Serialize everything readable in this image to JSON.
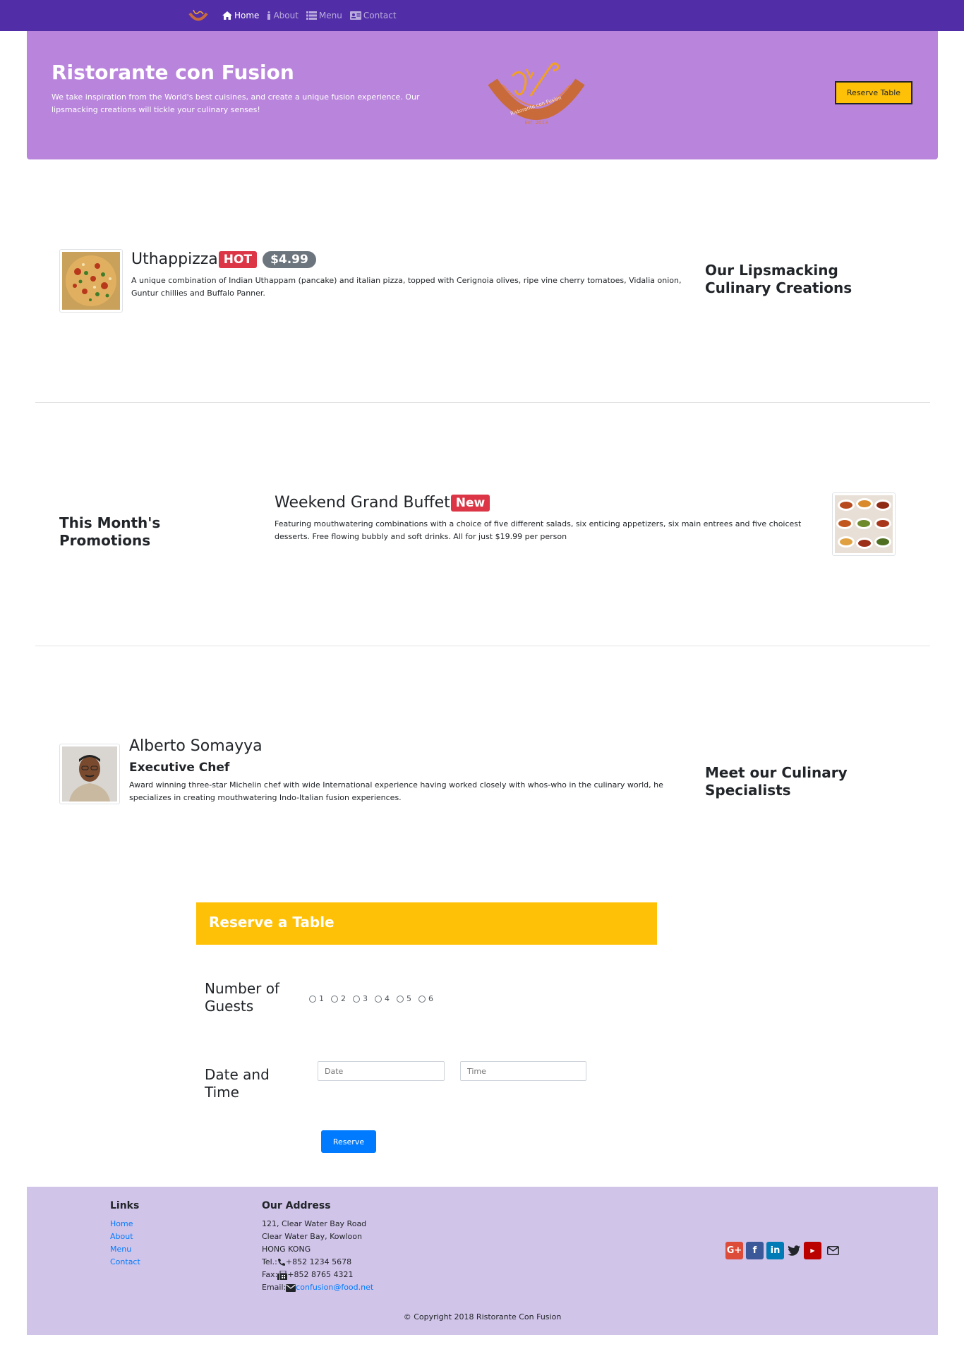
{
  "nav": {
    "items": [
      {
        "label": "Home",
        "icon": "home-icon",
        "active": true
      },
      {
        "label": "About",
        "icon": "info-icon",
        "active": false
      },
      {
        "label": "Menu",
        "icon": "list-icon",
        "active": false
      },
      {
        "label": "Contact",
        "icon": "address-card-icon",
        "active": false
      }
    ]
  },
  "jumbotron": {
    "title": "Ristorante con Fusion",
    "text": "We take inspiration from the World's best cuisines, and create a unique fusion experience. Our lipsmacking creations will tickle your culinary senses!",
    "reserve_label": "Reserve Table",
    "logo_text": "Ristorante con Fusion",
    "logo_est": "Est. 2013"
  },
  "dish": {
    "name": "Uthappizza",
    "badge": "HOT",
    "price": "$4.99",
    "description": "A unique combination of Indian Uthappam (pancake) and italian pizza, topped with Cerignoia olives, ripe vine cherry tomatoes, Vidalia onion, Guntur chillies and Buffalo Panner.",
    "side_heading": "Our Lipsmacking Culinary Creations"
  },
  "promotion": {
    "side_heading": "This Month's Promotions",
    "name": "Weekend Grand Buffet",
    "badge": "New",
    "description": "Featuring mouthwatering combinations with a choice of five different salads, six enticing appetizers, six main entrees and five choicest desserts. Free flowing bubbly and soft drinks. All for just $19.99 per person"
  },
  "leader": {
    "name": "Alberto Somayya",
    "designation": "Executive Chef",
    "description": "Award winning three-star Michelin chef with wide International experience having worked closely with whos-who in the culinary world, he specializes in creating mouthwatering Indo-Italian fusion experiences.",
    "side_heading": "Meet our Culinary Specialists"
  },
  "reserve": {
    "header": "Reserve a Table",
    "guests_label": "Number of Guests",
    "guest_options": [
      "1",
      "2",
      "3",
      "4",
      "5",
      "6"
    ],
    "datetime_label": "Date and Time",
    "date_placeholder": "Date",
    "time_placeholder": "Time",
    "button": "Reserve"
  },
  "footer": {
    "links_heading": "Links",
    "links": [
      "Home",
      "About",
      "Menu",
      "Contact"
    ],
    "address_heading": "Our Address",
    "address_lines": [
      "121, Clear Water Bay Road",
      "Clear Water Bay, Kowloon",
      "HONG KONG"
    ],
    "tel_label": "Tel.:",
    "tel": "+852 1234 5678",
    "fax_label": "Fax:",
    "fax": "+852 8765 4321",
    "email_label": "Email:",
    "email": "confusion@food.net",
    "social": [
      "google-plus-icon",
      "facebook-icon",
      "linkedin-icon",
      "twitter-icon",
      "youtube-icon",
      "mail-icon"
    ],
    "copyright": "© Copyright 2018 Ristorante Con Fusion"
  },
  "colors": {
    "navbar": "#512DA8",
    "jumbotron": "#B985DC",
    "accent": "#FFC107",
    "footer": "#D1C4E9",
    "link": "#007bff",
    "badge_red": "#dc3545",
    "badge_gray": "#6c757d"
  }
}
